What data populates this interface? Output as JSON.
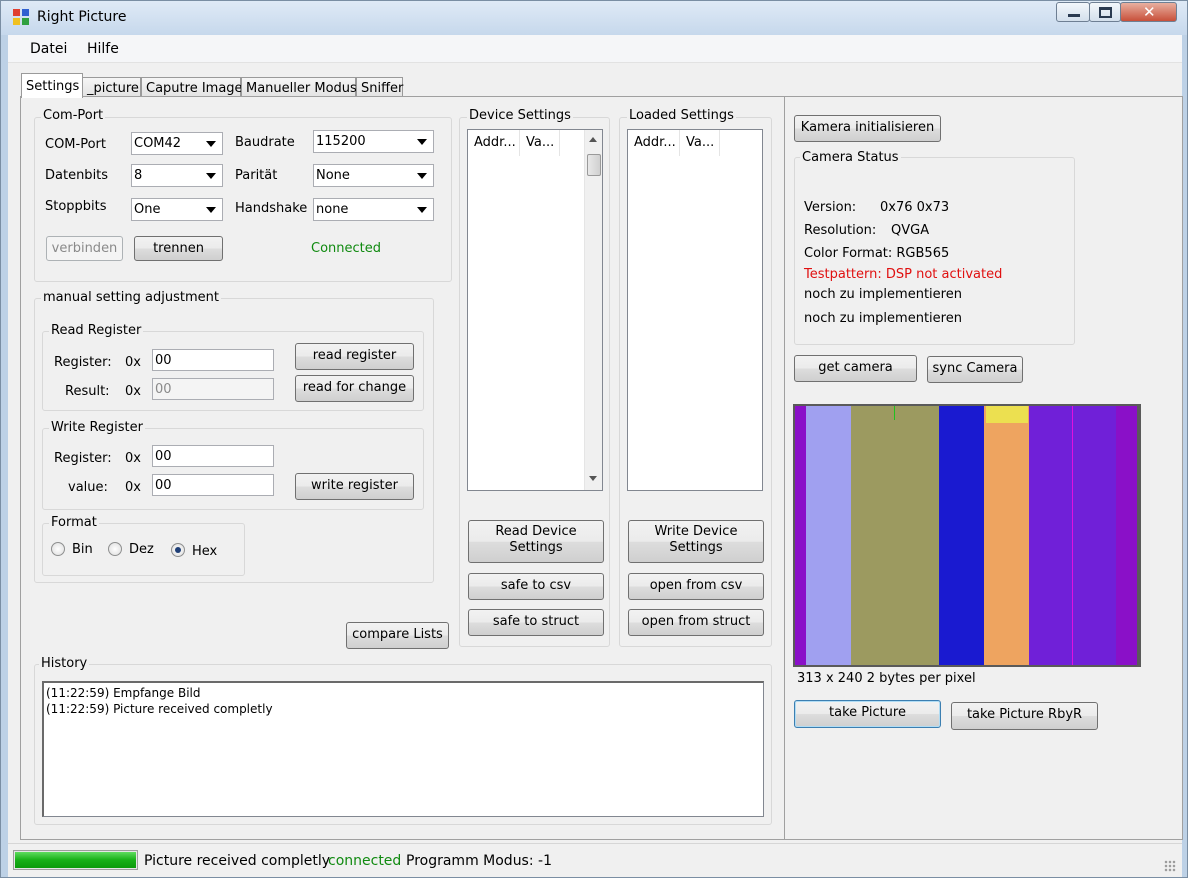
{
  "window": {
    "title": "Right Picture"
  },
  "menu": {
    "items": [
      "Datei",
      "Hilfe"
    ]
  },
  "tabs": [
    "Settings",
    "_picture",
    "Caputre Image",
    "Manueller Modus",
    "Sniffer"
  ],
  "comport": {
    "group_label": "Com-Port",
    "com_label": "COM-Port",
    "com_value": "COM42",
    "baud_label": "Baudrate",
    "baud_value": "115200",
    "databits_label": "Datenbits",
    "databits_value": "8",
    "parity_label": "Parität",
    "parity_value": "None",
    "stopbits_label": "Stoppbits",
    "stopbits_value": "One",
    "handshake_label": "Handshake",
    "handshake_value": "none",
    "connect_button": "verbinden",
    "disconnect_button": "trennen",
    "status": "Connected"
  },
  "manual": {
    "group_label": "manual setting adjustment",
    "read": {
      "group_label": "Read Register",
      "register_label": "Register:",
      "prefix": "0x",
      "register_value": "00",
      "result_label": "Result:",
      "result_value": "00",
      "read_button": "read register",
      "read_change_button": "read for change"
    },
    "write": {
      "group_label": "Write Register",
      "register_label": "Register:",
      "prefix": "0x",
      "register_value": "00",
      "value_label": "value:",
      "value_value": "00",
      "write_button": "write register"
    },
    "format": {
      "group_label": "Format",
      "options": [
        "Bin",
        "Dez",
        "Hex"
      ],
      "selected": "Hex"
    }
  },
  "compare_button": "compare Lists",
  "device_settings": {
    "group_label": "Device Settings",
    "columns": [
      "Addr...",
      "Va..."
    ],
    "read_button": "Read Device Settings",
    "safe_csv": "safe to csv",
    "safe_struct": "safe to struct"
  },
  "loaded_settings": {
    "group_label": "Loaded Settings",
    "columns": [
      "Addr...",
      "Va..."
    ],
    "write_button": "Write Device Settings",
    "open_csv": "open from csv",
    "open_struct": "open from struct"
  },
  "history": {
    "group_label": "History",
    "lines": [
      "(11:22:59) Empfange Bild",
      "(11:22:59) Picture received completly"
    ]
  },
  "camera": {
    "init_button": "Kamera initialisieren",
    "status_label": "Camera Status",
    "version_label": "Version:",
    "version_value": "0x76 0x73",
    "resolution_label": "Resolution:",
    "resolution_value": "QVGA",
    "color_format": "Color Format: RGB565",
    "testpattern": "Testpattern: DSP not activated",
    "todo1": "noch zu implementieren",
    "todo2": "noch zu implementieren",
    "get_button": "get camera",
    "sync_button": "sync Camera",
    "picture_info": "313 x 240 2 bytes per pixel",
    "take_button": "take Picture",
    "take_rbyr_button": "take Picture RbyR",
    "colors": {
      "dark_purple": "#8a10c8",
      "lavender": "#a0a0f0",
      "olive": "#9c9a60",
      "blue": "#1a1ad0",
      "orange": "#eea460",
      "yellow": "#ece050",
      "violet": "#7020d8",
      "magenta_line": "#e010e0",
      "green_line": "#20c020"
    }
  },
  "status": {
    "progress": 100,
    "message": "Picture received completly",
    "connection": "connected",
    "mode": "Programm Modus: -1"
  }
}
